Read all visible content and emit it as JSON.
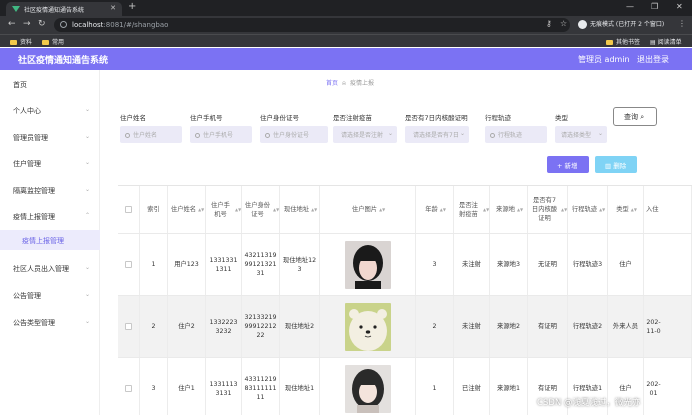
{
  "browser": {
    "tab_title": "社区疫情通知通告系统",
    "url_host": "localhost",
    "url_rest": ":8081/#/shangbao",
    "incognito": "无痕模式 (已打开 2 个窗口)",
    "bookmarks": [
      "资料",
      "常用"
    ],
    "bookmarks_right": [
      "其他书签",
      "阅读清单"
    ]
  },
  "header": {
    "title": "社区疫情通知通告系统",
    "user": "管理员 admin",
    "logout": "退出登录",
    "bg_color": "#7b72f3"
  },
  "sidebar": {
    "items": [
      {
        "label": "首页"
      },
      {
        "label": "个人中心"
      },
      {
        "label": "管理员管理"
      },
      {
        "label": "住户管理"
      },
      {
        "label": "隔离监控管理"
      },
      {
        "label": "疫情上报管理"
      },
      {
        "label": "疫情上报管理"
      },
      {
        "label": "社区人员出入管理"
      },
      {
        "label": "公告管理"
      },
      {
        "label": "公告类型管理"
      }
    ]
  },
  "breadcrumb": {
    "home": "首页",
    "current": "疫情上报"
  },
  "filters": [
    {
      "label": "住户姓名",
      "placeholder": "住户姓名"
    },
    {
      "label": "住户手机号",
      "placeholder": "住户手机号"
    },
    {
      "label": "住户身份证号",
      "placeholder": "住户身份证号"
    },
    {
      "label": "是否注射疫苗",
      "placeholder": "请选择是否注射"
    },
    {
      "label": "是否有7日内核酸证明",
      "placeholder": "请选择是否有7日"
    },
    {
      "label": "行程轨迹",
      "placeholder": "行程轨迹"
    },
    {
      "label": "类型",
      "placeholder": "请选择类型"
    }
  ],
  "buttons": {
    "query": "查询",
    "add": "新增",
    "delete": "删除"
  },
  "table": {
    "headers": [
      "",
      "索引",
      "住户姓名",
      "住户手机号",
      "住户身份证号",
      "现住地址",
      "住户图片",
      "年龄",
      "是否注射疫苗",
      "来源地",
      "是否有7日内核酸证明",
      "行程轨迹",
      "类型",
      "入住"
    ],
    "rows": [
      {
        "index": "1",
        "name": "用户123",
        "phone": "13313311311",
        "idcard": "432113199912132131",
        "address": "现住地址123",
        "age": "3",
        "vaccine": "未注射",
        "source": "来源地3",
        "nucleic": "无证明",
        "track": "行程轨迹3",
        "type": "住户",
        "checkin": ""
      },
      {
        "index": "2",
        "name": "住户2",
        "phone": "13322233232",
        "idcard": "321332199991221222",
        "address": "现住地址2",
        "age": "2",
        "vaccine": "未注射",
        "source": "来源地2",
        "nucleic": "有证明",
        "track": "行程轨迹2",
        "type": "外来人员",
        "checkin": "202-11-0"
      },
      {
        "index": "3",
        "name": "住户1",
        "phone": "13311133131",
        "idcard": "433112198311111111",
        "address": "现住地址1",
        "age": "1",
        "vaccine": "已注射",
        "source": "来源地1",
        "nucleic": "有证明",
        "track": "行程轨迹1",
        "type": "住户",
        "checkin": "202-01"
      }
    ]
  },
  "watermark": "CSDN @浅夏浅过，微光亦"
}
